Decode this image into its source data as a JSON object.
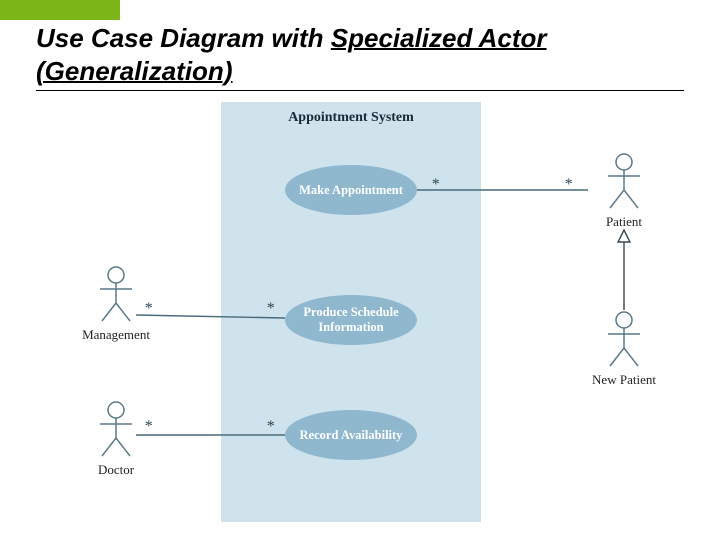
{
  "title": {
    "pre": "Use Case Diagram with ",
    "hl1": "Specialized Actor",
    "line2": "(Generalization)"
  },
  "system": {
    "name": "Appointment System"
  },
  "usecases": {
    "uc1": "Make Appointment",
    "uc2": "Produce Schedule Information",
    "uc3": "Record Availability"
  },
  "actors": {
    "mgmt": "Management",
    "doctor": "Doctor",
    "patient": "Patient",
    "newpatient": "New Patient"
  },
  "mult": {
    "star": "*"
  }
}
